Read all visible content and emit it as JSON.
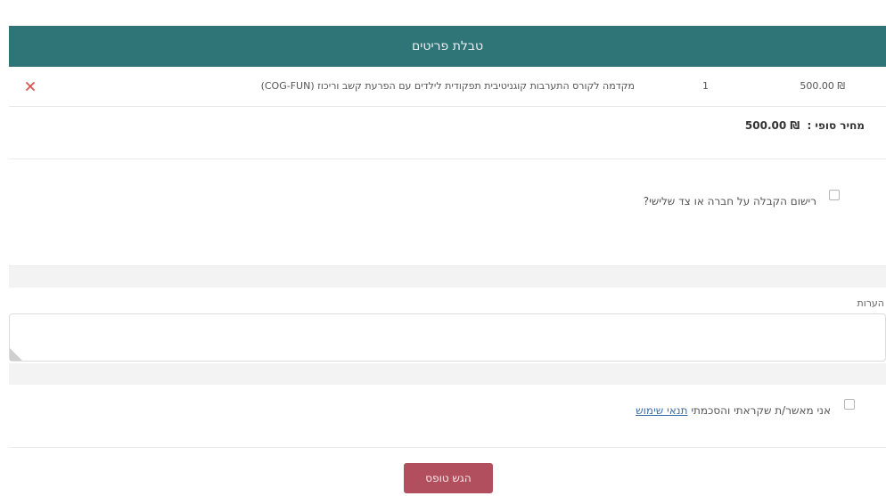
{
  "table": {
    "title": "טבלת פריטים",
    "rows": [
      {
        "name": "מקדמה לקורס התערבות קוגניטיבית תפקודית לילדים עם הפרעת קשב וריכוז (COG-FUN)",
        "qty": "1",
        "price": "₪ 500.00"
      }
    ],
    "remove_icon": "close-x-icon",
    "remove_color": "#d9534f",
    "header_color": "#2f7477"
  },
  "total": {
    "label": "מחיר סופי :",
    "value": "₪ 500.00"
  },
  "third_party": {
    "label": "רישום הקבלה על חברה או צד שלישי?"
  },
  "notes": {
    "label": "הערות",
    "value": "",
    "placeholder": ""
  },
  "terms": {
    "label": "אני מאשר/ת שקראתי והסכמתי",
    "link_text": "תנאי שימוש"
  },
  "submit": {
    "label": "הגש טופס",
    "color": "#b14f5e"
  }
}
